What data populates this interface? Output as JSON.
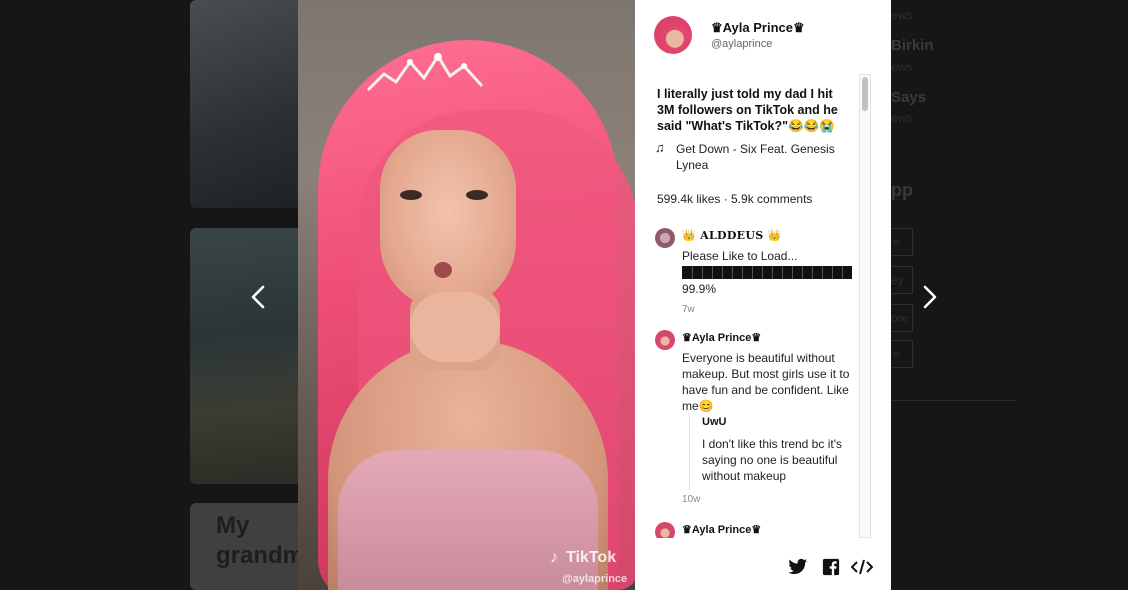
{
  "background": {
    "card3_text": "My grandm",
    "right_items": [
      {
        "title": "",
        "sub": "ews"
      },
      {
        "title": "Birkin",
        "sub": "ews"
      },
      {
        "title": "Says",
        "sub": "ews"
      },
      {
        "title": "pp",
        "sub": ""
      }
    ],
    "right_buttons": [
      "e",
      "ey",
      "ore",
      "e"
    ]
  },
  "post": {
    "display_name": "♛Ayla Prince♛",
    "username": "@aylaprince",
    "caption": "I literally just told my dad I hit 3M followers on TikTok and he said \"What's TikTok?\"😂😂😭",
    "music_icon": "music-note-icon",
    "music": "Get Down - Six Feat. Genesis Lynea",
    "stats": "599.4k likes · 5.9k comments",
    "watermark_brand": "TikTok",
    "watermark_handle": "@aylaprince"
  },
  "comments": [
    {
      "name": "👑 ALDDEUS 👑",
      "text": "Please Like to Load...",
      "progress_label": "99.9%",
      "progress": 0.999,
      "time": "7w"
    },
    {
      "name": "♛Ayla Prince♛",
      "text": "Everyone is beautiful without makeup. But most girls use it to have fun and be confident. Like me😊",
      "reply_name": "UwU",
      "reply_text": "I don't like this trend bc it's saying no one is beautiful without makeup",
      "time": "10w"
    },
    {
      "name": "♛Ayla Prince♛"
    }
  ],
  "footer": {
    "icons": [
      "twitter-icon",
      "facebook-icon",
      "embed-icon"
    ]
  },
  "colors": {
    "panel_bg": "#ffffff",
    "backdrop": "#161616",
    "hair": "#ef4f76"
  }
}
